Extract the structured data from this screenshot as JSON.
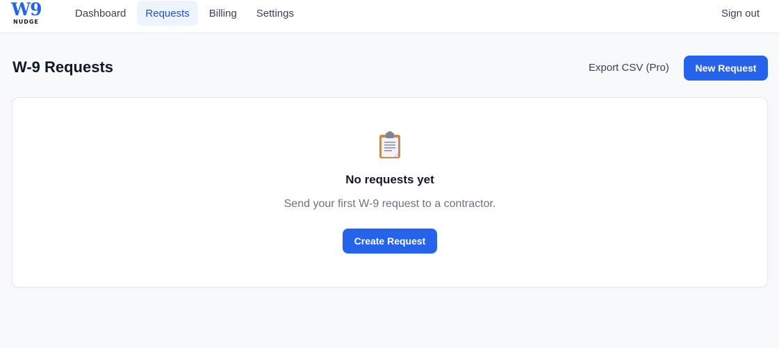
{
  "brand": {
    "mark": "W9",
    "wordmark": "NUDGE",
    "color": "#2563eb"
  },
  "nav": {
    "items": [
      {
        "label": "Dashboard"
      },
      {
        "label": "Requests",
        "active": true
      },
      {
        "label": "Billing"
      },
      {
        "label": "Settings"
      }
    ],
    "sign_out": "Sign out"
  },
  "header": {
    "title": "W-9 Requests",
    "export_label": "Export CSV (Pro)",
    "new_request_label": "New Request"
  },
  "empty_state": {
    "icon": "clipboard-icon",
    "title": "No requests yet",
    "subtitle": "Send your first W-9 request to a contractor.",
    "cta_label": "Create Request"
  },
  "colors": {
    "accent": "#2563eb",
    "active_nav_bg": "#eef4fe",
    "page_bg": "#f8f9fb"
  }
}
